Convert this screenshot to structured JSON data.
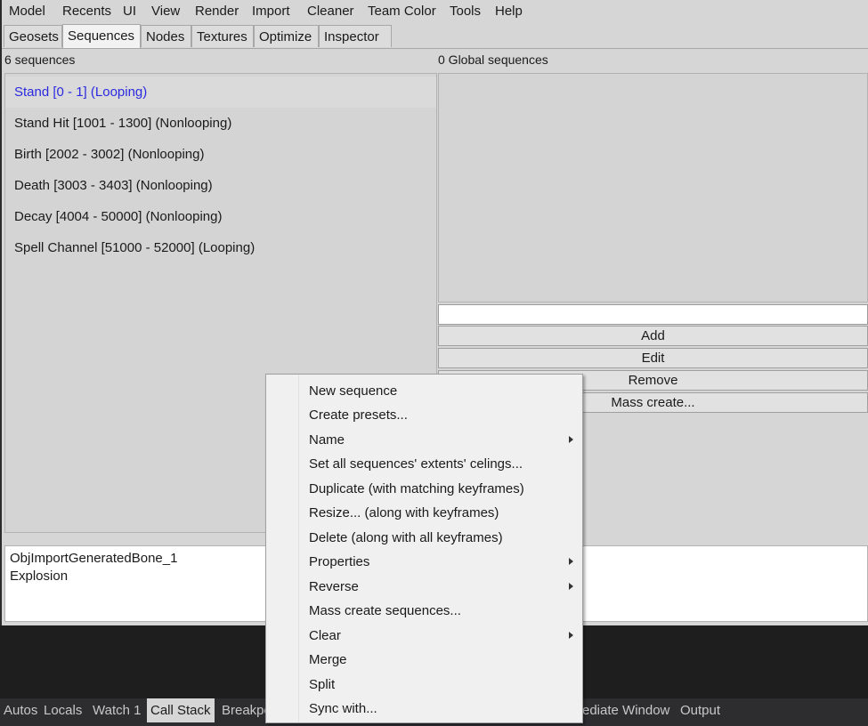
{
  "menubar": {
    "items": [
      "Model",
      "Recents",
      "UI",
      "View",
      "Render",
      "Import",
      "Cleaner",
      "Team Color",
      "Tools",
      "Help"
    ]
  },
  "tabs": {
    "items": [
      "Geosets",
      "Sequences",
      "Nodes",
      "Textures",
      "Optimize",
      "Inspector"
    ],
    "active": "Sequences"
  },
  "sequences": {
    "count_label": "6 sequences",
    "items": [
      "Stand [0 - 1] (Looping)",
      "Stand Hit [1001 - 1300] (Nonlooping)",
      "Birth [2002 - 3002] (Nonlooping)",
      "Death [3003 - 3403] (Nonlooping)",
      "Decay [4004 - 50000] (Nonlooping)",
      "Spell Channel [51000 - 52000] (Looping)"
    ],
    "selected": "Stand [0 - 1] (Looping)"
  },
  "global_sequences": {
    "count_label": "0 Global sequences",
    "input_value": "",
    "buttons": {
      "add": "Add",
      "edit": "Edit",
      "remove": "Remove",
      "mass_create": "Mass create..."
    }
  },
  "bones": {
    "items": [
      "ObjImportGeneratedBone_1",
      "Explosion"
    ]
  },
  "context_menu": {
    "items": [
      {
        "label": "New sequence",
        "submenu": false
      },
      {
        "label": "Create presets...",
        "submenu": false
      },
      {
        "label": "Name",
        "submenu": true
      },
      {
        "label": "Set all sequences' extents' celings...",
        "submenu": false
      },
      {
        "label": "Duplicate (with matching keyframes)",
        "submenu": false
      },
      {
        "label": "Resize... (along with keyframes)",
        "submenu": false
      },
      {
        "label": "Delete (along with all keyframes)",
        "submenu": false
      },
      {
        "label": "Properties",
        "submenu": true
      },
      {
        "label": "Reverse",
        "submenu": true
      },
      {
        "label": "Mass create sequences...",
        "submenu": false
      },
      {
        "label": "Clear",
        "submenu": true
      },
      {
        "label": "Merge",
        "submenu": false
      },
      {
        "label": "Split",
        "submenu": false
      },
      {
        "label": "Sync with...",
        "submenu": false
      }
    ]
  },
  "bottom_tabs": {
    "items": [
      "Autos",
      "Locals",
      "Watch 1",
      "Call Stack",
      "Breakpo",
      "ediate Window",
      "Output"
    ],
    "active": "Call Stack"
  },
  "colors": {
    "selected_text": "#2a2ae0",
    "window_bg": "#d6d6d6",
    "dark_bg": "#1e1e1e"
  }
}
